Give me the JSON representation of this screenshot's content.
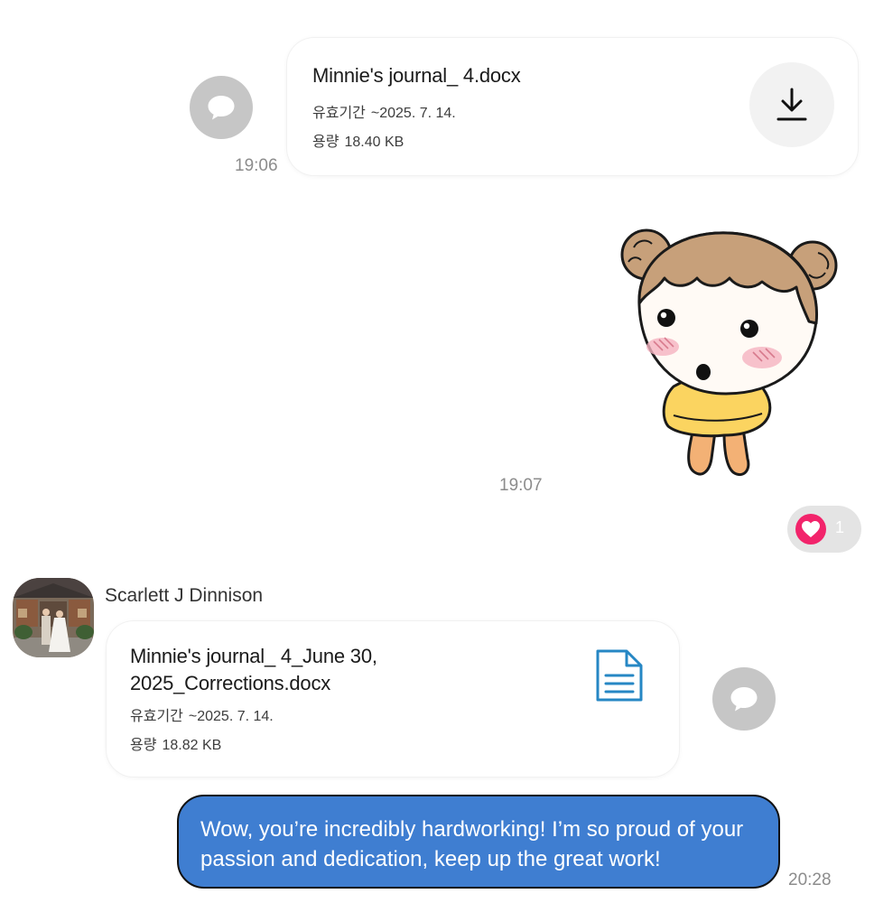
{
  "messages": [
    {
      "type": "file",
      "filename": "Minnie's journal_ 4.docx",
      "expiry_label": "유효기간",
      "expiry": "~2025. 7. 14.",
      "size_label": "용량",
      "size": "18.40 KB",
      "time": "19:06",
      "icon": "download-icon"
    },
    {
      "type": "sticker",
      "icon": "girl-sticker",
      "time": "19:07",
      "reaction": {
        "icon": "heart-icon",
        "count": "1",
        "color": "#f2246b"
      }
    },
    {
      "type": "file",
      "sender": "Scarlett J Dinnison",
      "filename": "Minnie's journal_ 4_June 30, 2025_Corrections.docx",
      "expiry_label": "유효기간",
      "expiry": "~2025. 7. 14.",
      "size_label": "용량",
      "size": "18.82 KB",
      "icon": "document-icon"
    },
    {
      "type": "text",
      "text": "Wow, you’re incredibly hardworking! I’m so proud of your passion and dedication, keep up the great work!",
      "time": "20:28",
      "bubble_color": "#3f7ed1"
    }
  ]
}
